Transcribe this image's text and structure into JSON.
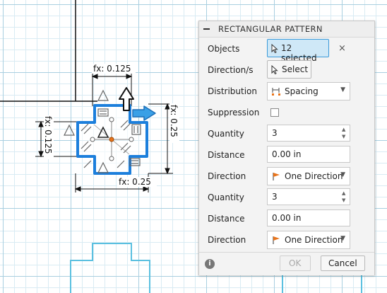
{
  "canvas": {
    "dimensions": {
      "top": "fx: 0.125",
      "left": "fx: 0.125",
      "right": "fx: 0.25",
      "bottom": "fx: 0.25"
    }
  },
  "panel": {
    "title": "RECTANGULAR PATTERN",
    "rows": {
      "objects": {
        "label": "Objects",
        "value": "12 selected"
      },
      "direction": {
        "label": "Direction/s",
        "value": "Select"
      },
      "distribution": {
        "label": "Distribution",
        "value": "Spacing"
      },
      "suppression": {
        "label": "Suppression",
        "checked": false
      },
      "quantity1": {
        "label": "Quantity",
        "value": "3"
      },
      "distance1": {
        "label": "Distance",
        "value": "0.00 in"
      },
      "direction1": {
        "label": "Direction",
        "value": "One Direction"
      },
      "quantity2": {
        "label": "Quantity",
        "value": "3"
      },
      "distance2": {
        "label": "Distance",
        "value": "0.00 in"
      },
      "direction2": {
        "label": "Direction",
        "value": "One Direction"
      }
    },
    "footer": {
      "ok": "OK",
      "cancel": "Cancel",
      "info": "i"
    }
  },
  "colors": {
    "selection_blue": "#1c7fdc",
    "grid_major": "#a9cfe0",
    "grid_minor": "#d9ebf3",
    "sketch_cyan": "#5bc0e0"
  }
}
